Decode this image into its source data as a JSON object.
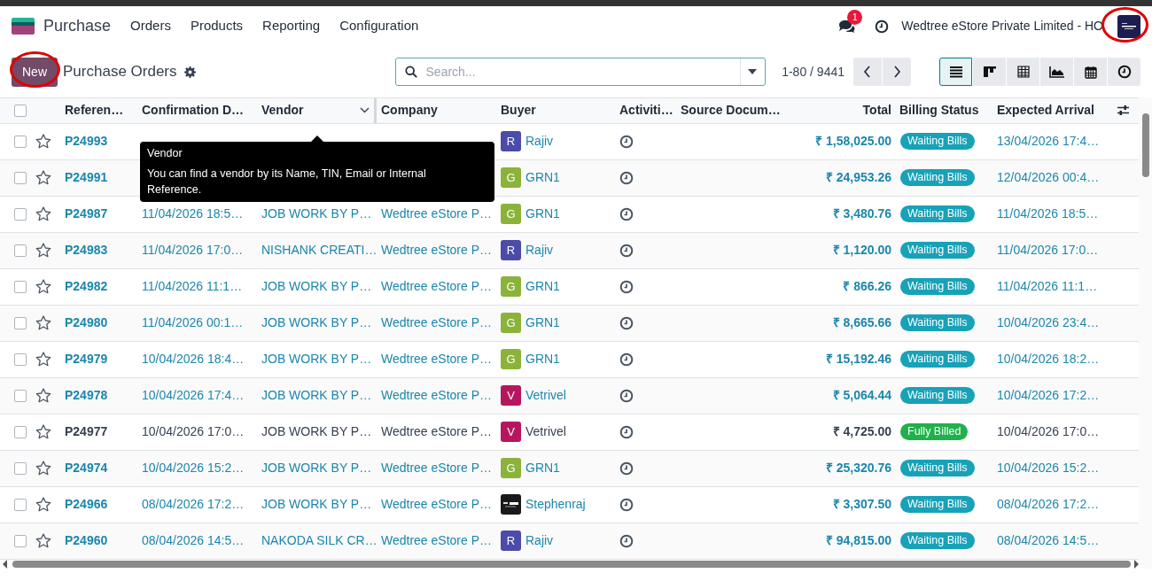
{
  "navbar": {
    "app_name": "Purchase",
    "menu": [
      "Orders",
      "Products",
      "Reporting",
      "Configuration"
    ],
    "chat_badge": "1",
    "company": "Wedtree eStore Private Limited - HO"
  },
  "control_panel": {
    "new_button": "New",
    "title": "Purchase Orders",
    "search": {
      "placeholder": "Search..."
    },
    "pager": "1-80 / 9441",
    "views": [
      {
        "kind": "list",
        "selected": true
      },
      {
        "kind": "kanban",
        "selected": false
      },
      {
        "kind": "pivot",
        "selected": false
      },
      {
        "kind": "graph",
        "selected": false
      },
      {
        "kind": "calendar",
        "selected": false
      },
      {
        "kind": "activity",
        "selected": false
      }
    ]
  },
  "table": {
    "header_checked": false,
    "columns": [
      "Referen…",
      "Confirmation D…",
      "Vendor",
      "Company",
      "Buyer",
      "Activiti…",
      "Source Docum…",
      "Total",
      "Billing Status",
      "Expected Arrival"
    ],
    "rows": [
      {
        "checked": false,
        "ref": "P24993",
        "buyer": {
          "kind": "letter",
          "letter": "R",
          "color": "#4b4ba9",
          "name": "Rajiv"
        },
        "total": "₹ 1,58,025.00",
        "status": {
          "kind": "waiting",
          "label": "Waiting Bills"
        },
        "expected": "13/04/2026 17:4…"
      },
      {
        "checked": false,
        "ref": "P24991",
        "buyer": {
          "kind": "letter",
          "letter": "G",
          "color": "#8bb33a",
          "name": "GRN1"
        },
        "total": "₹ 24,953.26",
        "status": {
          "kind": "waiting",
          "label": "Waiting Bills"
        },
        "expected": "12/04/2026 00:4…"
      },
      {
        "checked": false,
        "ref": "P24987",
        "date": "11/04/2026 18:5…",
        "vendor": "JOB WORK BY P…",
        "company": "Wedtree eStore P…",
        "buyer": {
          "kind": "letter",
          "letter": "G",
          "color": "#8bb33a",
          "name": "GRN1"
        },
        "total": "₹ 3,480.76",
        "status": {
          "kind": "waiting",
          "label": "Waiting Bills"
        },
        "expected": "11/04/2026 18:5…"
      },
      {
        "checked": false,
        "ref": "P24983",
        "date": "11/04/2026 17:0…",
        "vendor": "NISHANK CREATI…",
        "company": "Wedtree eStore P…",
        "buyer": {
          "kind": "letter",
          "letter": "R",
          "color": "#4b4ba9",
          "name": "Rajiv"
        },
        "total": "₹ 1,120.00",
        "status": {
          "kind": "waiting",
          "label": "Waiting Bills"
        },
        "expected": "11/04/2026 17:0…"
      },
      {
        "checked": false,
        "ref": "P24982",
        "date": "11/04/2026 11:1…",
        "vendor": "JOB WORK BY P…",
        "company": "Wedtree eStore P…",
        "buyer": {
          "kind": "letter",
          "letter": "G",
          "color": "#8bb33a",
          "name": "GRN1"
        },
        "total": "₹ 866.26",
        "status": {
          "kind": "waiting",
          "label": "Waiting Bills"
        },
        "expected": "11/04/2026 11:1…"
      },
      {
        "checked": false,
        "ref": "P24980",
        "date": "11/04/2026 00:1…",
        "vendor": "JOB WORK BY P…",
        "company": "Wedtree eStore P…",
        "buyer": {
          "kind": "letter",
          "letter": "G",
          "color": "#8bb33a",
          "name": "GRN1"
        },
        "total": "₹ 8,665.66",
        "status": {
          "kind": "waiting",
          "label": "Waiting Bills"
        },
        "expected": "10/04/2026 23:4…"
      },
      {
        "checked": false,
        "ref": "P24979",
        "date": "10/04/2026 18:4…",
        "vendor": "JOB WORK BY P…",
        "company": "Wedtree eStore P…",
        "buyer": {
          "kind": "letter",
          "letter": "G",
          "color": "#8bb33a",
          "name": "GRN1"
        },
        "total": "₹ 15,192.46",
        "status": {
          "kind": "waiting",
          "label": "Waiting Bills"
        },
        "expected": "10/04/2026 18:2…"
      },
      {
        "checked": false,
        "ref": "P24978",
        "date": "10/04/2026 17:4…",
        "vendor": "JOB WORK BY P…",
        "company": "Wedtree eStore P…",
        "buyer": {
          "kind": "letter",
          "letter": "V",
          "color": "#b5175e",
          "name": "Vetrivel"
        },
        "total": "₹ 5,064.44",
        "status": {
          "kind": "waiting",
          "label": "Waiting Bills"
        },
        "expected": "10/04/2026 17:2…"
      },
      {
        "checked": false,
        "ref": "P24977",
        "date": "10/04/2026 17:0…",
        "vendor": "JOB WORK BY P…",
        "company": "Wedtree eStore P…",
        "buyer": {
          "kind": "letter",
          "letter": "V",
          "color": "#b5175e",
          "name": "Vetrivel"
        },
        "total": "₹ 4,725.00",
        "status": {
          "kind": "billed",
          "label": "Fully Billed"
        },
        "expected": "10/04/2026 17:0…"
      },
      {
        "checked": false,
        "ref": "P24974",
        "date": "10/04/2026 15:2…",
        "vendor": "JOB WORK BY P…",
        "company": "Wedtree eStore P…",
        "buyer": {
          "kind": "letter",
          "letter": "G",
          "color": "#8bb33a",
          "name": "GRN1"
        },
        "total": "₹ 25,320.76",
        "status": {
          "kind": "waiting",
          "label": "Waiting Bills"
        },
        "expected": "10/04/2026 15:2…"
      },
      {
        "checked": false,
        "ref": "P24966",
        "date": "08/04/2026 17:2…",
        "vendor": "JOB WORK BY P…",
        "company": "Wedtree eStore P…",
        "buyer": {
          "kind": "image",
          "color": "#1a1a1a",
          "name": "Stephenraj"
        },
        "total": "₹ 3,307.50",
        "status": {
          "kind": "waiting",
          "label": "Waiting Bills"
        },
        "expected": "08/04/2026 17:2…"
      },
      {
        "checked": false,
        "ref": "P24960",
        "date": "08/04/2026 14:5…",
        "vendor": "NAKODA SILK CR…",
        "company": "Wedtree eStore P…",
        "buyer": {
          "kind": "letter",
          "letter": "R",
          "color": "#4b4ba9",
          "name": "Rajiv"
        },
        "total": "₹ 94,815.00",
        "status": {
          "kind": "waiting",
          "label": "Waiting Bills"
        },
        "expected": "08/04/2026 14:5…"
      }
    ]
  },
  "tooltip": {
    "title": "Vendor",
    "text": "You can find a vendor by its Name, TIN, Email or Internal Reference."
  }
}
